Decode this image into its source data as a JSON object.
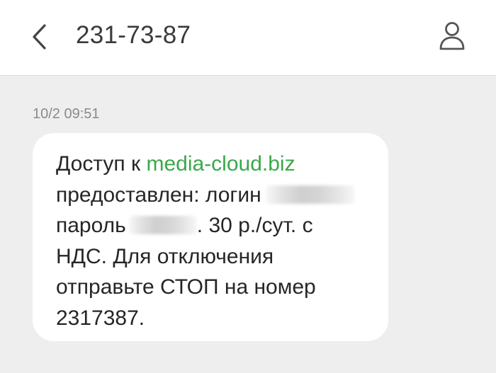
{
  "header": {
    "contact": "231-73-87",
    "back_icon": "chevron-left-icon",
    "contact_icon": "person-icon"
  },
  "thread": {
    "timestamp": "10/2 09:51",
    "message": {
      "line1_prefix": "Доступ к ",
      "link_text": "media-cloud.biz",
      "line2": "предоставлен: логин",
      "line3_prefix": "пароль",
      "line3_suffix": ". 30 р./сут. с",
      "line4": "НДС. Для отключения",
      "line5": "отправьте СТОП на номер",
      "line6": "2317387."
    }
  },
  "colors": {
    "link": "#3aa84a",
    "background": "#eeeeee",
    "bubble": "#ffffff"
  }
}
